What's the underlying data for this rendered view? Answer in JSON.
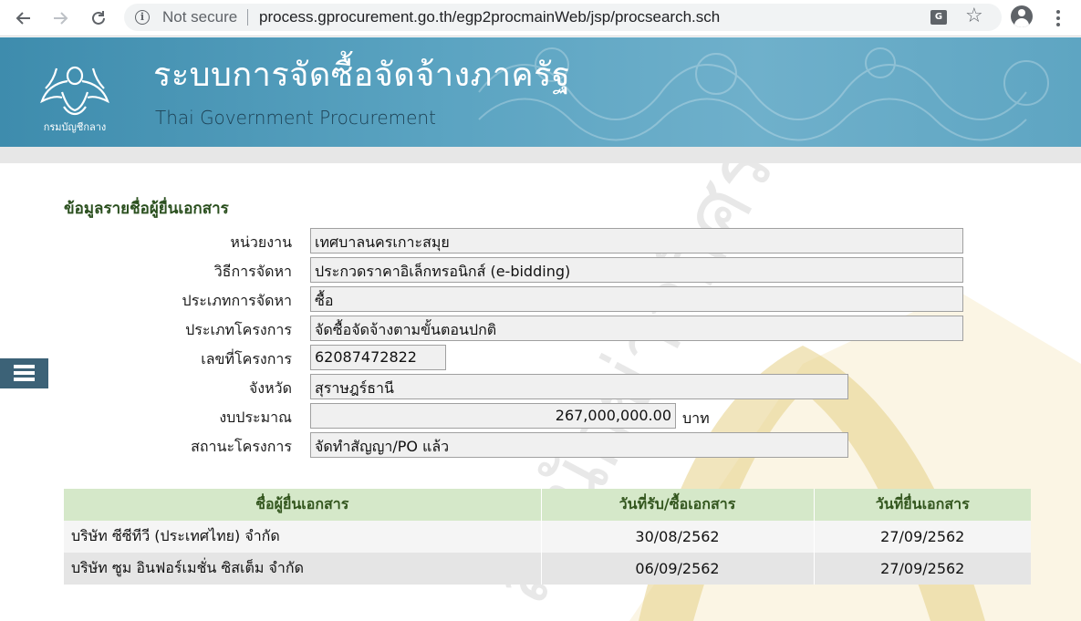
{
  "browser": {
    "security_label": "Not secure",
    "url": "process.gprocurement.go.th/egp2procmainWeb/jsp/procsearch.sch"
  },
  "header": {
    "title": "ระบบการจัดซื้อจัดจ้างภาครัฐ",
    "subtitle": "Thai Government Procurement",
    "logo_text": "กรมบัญชีกลาง"
  },
  "watermark": {
    "text": "สำนักข่าวอิศรา : https://www"
  },
  "form": {
    "section_title": "ข้อมูลรายชื่อผู้ยื่นเอกสาร",
    "fields": [
      {
        "label": "หน่วยงาน",
        "value": "เทศบาลนครเกาะสมุย"
      },
      {
        "label": "วิธีการจัดหา",
        "value": "ประกวดราคาอิเล็กทรอนิกส์ (e-bidding)"
      },
      {
        "label": "ประเภทการจัดหา",
        "value": "ซื้อ"
      },
      {
        "label": "ประเภทโครงการ",
        "value": "จัดซื้อจัดจ้างตามขั้นตอนปกติ"
      },
      {
        "label": "เลขที่โครงการ",
        "value": "62087472822"
      },
      {
        "label": "จังหวัด",
        "value": "สุราษฎร์ธานี"
      },
      {
        "label": "งบประมาณ",
        "value": "267,000,000.00",
        "unit": "บาท"
      },
      {
        "label": "สถานะโครงการ",
        "value": "จัดทำสัญญา/PO แล้ว"
      }
    ]
  },
  "table": {
    "headers": [
      "ชื่อผู้ยื่นเอกสาร",
      "วันที่รับ/ซื้อเอกสาร",
      "วันที่ยื่นเอกสาร"
    ],
    "rows": [
      [
        "บริษัท ซีซีทีวี (ประเทศไทย) จำกัด",
        "30/08/2562",
        "27/09/2562"
      ],
      [
        "บริษัท ซูม อินฟอร์เมชั่น ซิสเต็ม จำกัด",
        "06/09/2562",
        "27/09/2562"
      ]
    ]
  },
  "colors": {
    "banner": "#4e9ab9",
    "section_title": "#2a4f1e",
    "table_header_bg": "#d5e8c9",
    "watermark": "#e8d6a0"
  }
}
